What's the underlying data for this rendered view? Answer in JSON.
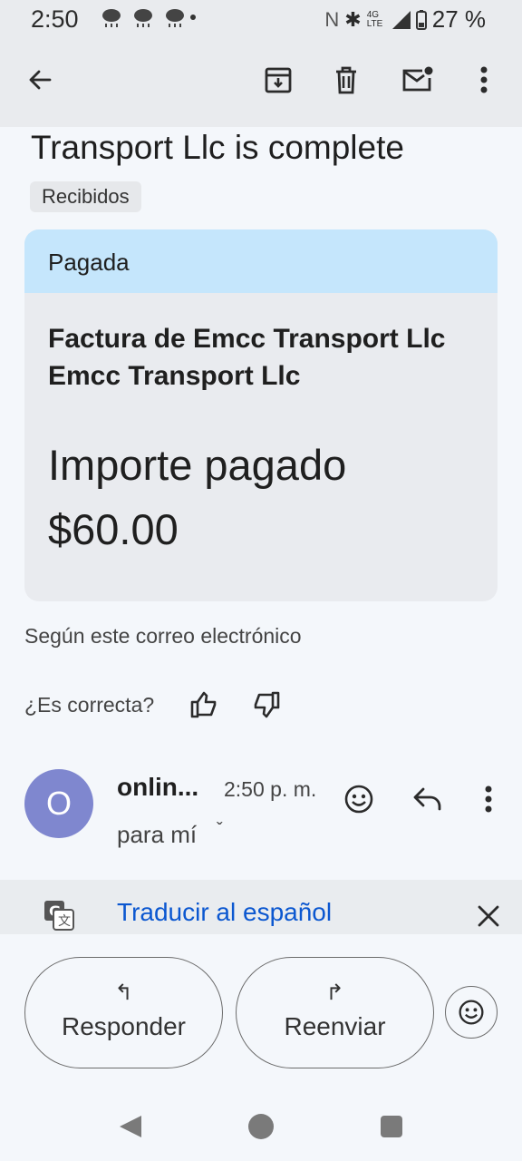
{
  "status_bar": {
    "time": "2:50",
    "nfc": "N",
    "bluetooth": "✱",
    "network": "4G LTE",
    "battery": "27 %"
  },
  "toolbar": {
    "back_icon": "arrow-left-icon",
    "archive_icon": "archive-icon",
    "delete_icon": "trash-icon",
    "mark_unread_icon": "mail-unread-icon",
    "more_icon": "more-vertical-icon"
  },
  "email": {
    "subject": "Transport Llc is complete",
    "label": "Recibidos"
  },
  "card": {
    "status": "Pagada",
    "title": "Factura de Emcc Transport Llc Emcc Transport Llc",
    "amount_label": "Importe pagado",
    "amount": "$60.00"
  },
  "feedback": {
    "according": "Según este correo electrónico",
    "question": "¿Es correcta?"
  },
  "message": {
    "avatar_letter": "O",
    "sender": "onlin...",
    "time": "2:50 p. m.",
    "to": "para mí",
    "chevron": "ˇ"
  },
  "translate": {
    "text": "Traducir al español"
  },
  "actions": {
    "reply": "Responder",
    "forward": "Reenviar",
    "reply_arrow": "↰",
    "forward_arrow": "↱"
  },
  "colors": {
    "accent": "#0b57d0",
    "card_header": "#c5e6fc",
    "avatar": "#7f87cf"
  }
}
